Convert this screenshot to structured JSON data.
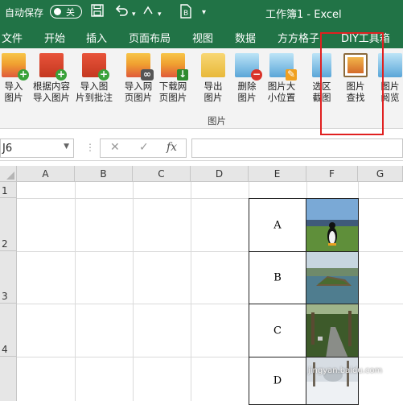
{
  "titlebar": {
    "autosave_label": "自动保存",
    "toggle_label": "关",
    "doc_title": "工作簿1 - Excel",
    "qat_icons": [
      "save-icon",
      "undo-icon",
      "redo-icon",
      "customize-icon",
      "file-icon"
    ]
  },
  "tabs": [
    "文件",
    "开始",
    "插入",
    "页面布局",
    "视图",
    "数据",
    "方方格子",
    "DIY工具箱"
  ],
  "ribbon": {
    "buttons": [
      {
        "line1": "导入",
        "line2": "图片",
        "icon": "image-add-icon"
      },
      {
        "line1": "根据内容",
        "line2": "导入图片",
        "icon": "image-add-icon"
      },
      {
        "line1": "导入图",
        "line2": "片到批注",
        "icon": "image-comment-icon"
      },
      {
        "line1": "导入网",
        "line2": "页图片",
        "icon": "image-link-icon"
      },
      {
        "line1": "下载网",
        "line2": "页图片",
        "icon": "image-download-icon"
      },
      {
        "line1": "导出",
        "line2": "图片",
        "icon": "folder-export-icon"
      },
      {
        "line1": "删除",
        "line2": "图片",
        "icon": "image-delete-icon"
      },
      {
        "line1": "图片大",
        "line2": "小位置",
        "icon": "image-resize-icon"
      },
      {
        "line1": "选区",
        "line2": "截图",
        "icon": "screenshot-icon"
      },
      {
        "line1": "图片",
        "line2": "查找",
        "icon": "image-search-icon"
      },
      {
        "line1": "图片",
        "line2": "阅览",
        "icon": "image-browse-icon"
      }
    ],
    "group_label": "图片"
  },
  "formula_bar": {
    "name_box": "J6",
    "cancel": "✕",
    "confirm": "✓",
    "fx": "fx",
    "value": ""
  },
  "sheet": {
    "columns": [
      "A",
      "B",
      "C",
      "D",
      "E",
      "F",
      "G"
    ],
    "rows": [
      "1",
      "2",
      "3",
      "4"
    ],
    "cells": [
      {
        "ref": "E2",
        "value": "A"
      },
      {
        "ref": "E3",
        "value": "B"
      },
      {
        "ref": "E4",
        "value": "C"
      },
      {
        "ref": "E5",
        "value": "D"
      }
    ],
    "images": [
      "penguin-photo",
      "island-photo",
      "road-photo",
      "winter-photo"
    ]
  },
  "watermark": "jingyan.baidu.com",
  "colors": {
    "excel_green": "#217346",
    "highlight": "#e02020"
  }
}
